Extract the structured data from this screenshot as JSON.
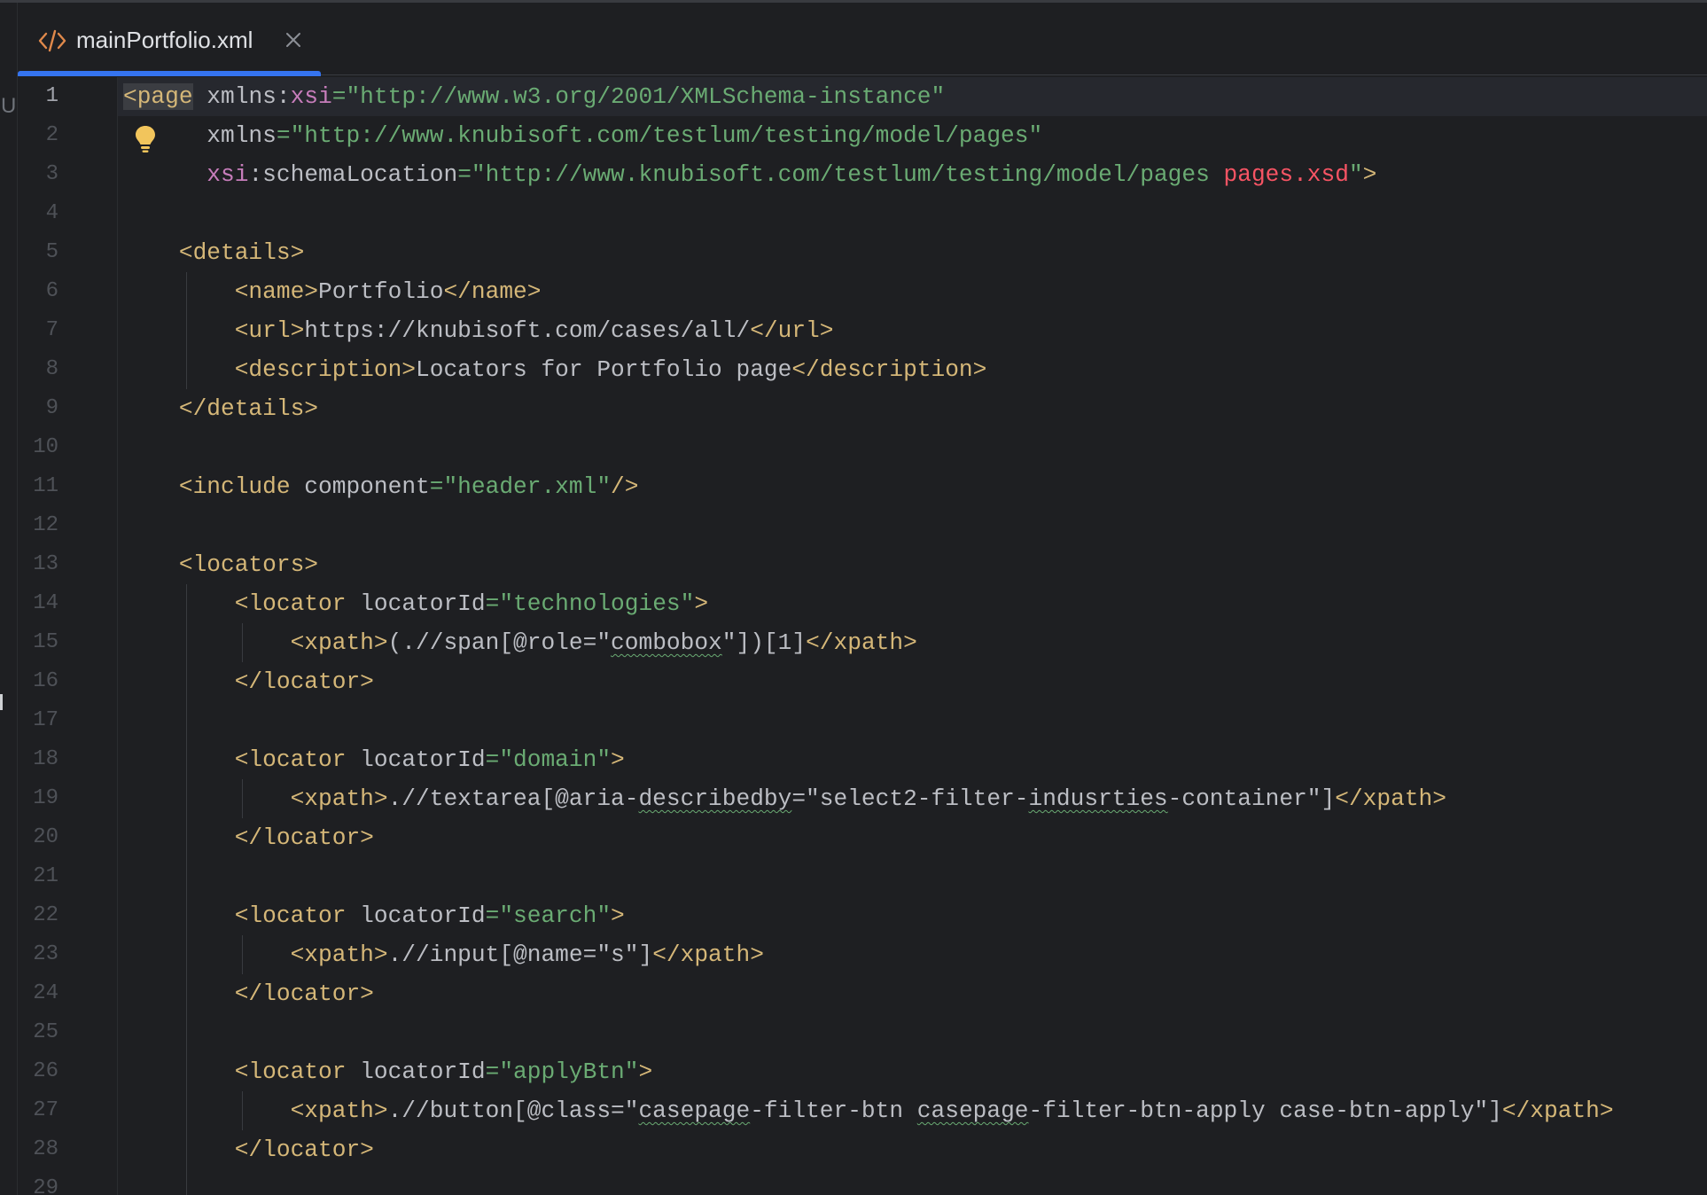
{
  "editor": {
    "tab": {
      "title": "mainPortfolio.xml",
      "icon": "xml-file-icon",
      "close_icon": "close-icon",
      "accent_color": "#3574f0"
    },
    "side_strip_label": "U",
    "colors": {
      "background": "#1e1f22",
      "tag": "#d5b778",
      "attribute": "#bcbec4",
      "namespace": "#c77dbb",
      "string": "#6aab73",
      "error": "#f75464",
      "line_number": "#4e5157"
    },
    "line_numbers": [
      "1",
      "2",
      "3",
      "4",
      "5",
      "6",
      "7",
      "8",
      "9",
      "10",
      "11",
      "12",
      "13",
      "14",
      "15",
      "16",
      "17",
      "18",
      "19",
      "20",
      "21",
      "22",
      "23",
      "24",
      "25",
      "26",
      "27",
      "28",
      "29"
    ],
    "code_lines": [
      [
        {
          "t": "<page",
          "c": "tag",
          "hl": true
        },
        {
          "t": " xmlns:",
          "c": "attr"
        },
        {
          "t": "xsi",
          "c": "ns"
        },
        {
          "t": "=\"http://www.w3.org/2001/XMLSchema-instance\"",
          "c": "str"
        }
      ],
      [
        {
          "t": "      xmlns",
          "c": "attr"
        },
        {
          "t": "=\"http://www.knubisoft.com/testlum/testing/model/pages\"",
          "c": "str"
        }
      ],
      [
        {
          "t": "      ",
          "c": "attr"
        },
        {
          "t": "xsi",
          "c": "ns"
        },
        {
          "t": ":schemaLocation",
          "c": "attr"
        },
        {
          "t": "=\"http://www.knubisoft.com/testlum/testing/model/pages ",
          "c": "str"
        },
        {
          "t": "pages.xsd",
          "c": "err"
        },
        {
          "t": "\"",
          "c": "str"
        },
        {
          "t": ">",
          "c": "tag"
        }
      ],
      [],
      [
        {
          "t": "    <details>",
          "c": "tag"
        }
      ],
      [
        {
          "t": "        <name>",
          "c": "tag"
        },
        {
          "t": "Portfolio",
          "c": "text"
        },
        {
          "t": "</name>",
          "c": "tag"
        }
      ],
      [
        {
          "t": "        <url>",
          "c": "tag"
        },
        {
          "t": "https://knubisoft.com/cases/all/",
          "c": "text"
        },
        {
          "t": "</url>",
          "c": "tag"
        }
      ],
      [
        {
          "t": "        <description>",
          "c": "tag"
        },
        {
          "t": "Locators for Portfolio page",
          "c": "text"
        },
        {
          "t": "</description>",
          "c": "tag"
        }
      ],
      [
        {
          "t": "    </details>",
          "c": "tag"
        }
      ],
      [],
      [
        {
          "t": "    <include",
          "c": "tag"
        },
        {
          "t": " component",
          "c": "attr"
        },
        {
          "t": "=\"header.xml\"",
          "c": "str"
        },
        {
          "t": "/>",
          "c": "tag"
        }
      ],
      [],
      [
        {
          "t": "    <locators>",
          "c": "tag"
        }
      ],
      [
        {
          "t": "        <locator",
          "c": "tag"
        },
        {
          "t": " locatorId",
          "c": "attr"
        },
        {
          "t": "=\"technologies\"",
          "c": "str"
        },
        {
          "t": ">",
          "c": "tag"
        }
      ],
      [
        {
          "t": "            <xpath>",
          "c": "tag"
        },
        {
          "t": "(.//span[@role=\"",
          "c": "text"
        },
        {
          "t": "combobox",
          "c": "text",
          "typo": true
        },
        {
          "t": "\"])[1]",
          "c": "text"
        },
        {
          "t": "</xpath>",
          "c": "tag"
        }
      ],
      [
        {
          "t": "        </locator>",
          "c": "tag"
        }
      ],
      [],
      [
        {
          "t": "        <locator",
          "c": "tag"
        },
        {
          "t": " locatorId",
          "c": "attr"
        },
        {
          "t": "=\"domain\"",
          "c": "str"
        },
        {
          "t": ">",
          "c": "tag"
        }
      ],
      [
        {
          "t": "            <xpath>",
          "c": "tag"
        },
        {
          "t": ".//textarea[@aria-",
          "c": "text"
        },
        {
          "t": "describedby",
          "c": "text",
          "typo": true
        },
        {
          "t": "=\"select2-filter-",
          "c": "text"
        },
        {
          "t": "indusrties",
          "c": "text",
          "typo": true
        },
        {
          "t": "-container\"]",
          "c": "text"
        },
        {
          "t": "</xpath>",
          "c": "tag"
        }
      ],
      [
        {
          "t": "        </locator>",
          "c": "tag"
        }
      ],
      [],
      [
        {
          "t": "        <locator",
          "c": "tag"
        },
        {
          "t": " locatorId",
          "c": "attr"
        },
        {
          "t": "=\"search\"",
          "c": "str"
        },
        {
          "t": ">",
          "c": "tag"
        }
      ],
      [
        {
          "t": "            <xpath>",
          "c": "tag"
        },
        {
          "t": ".//input[@name=\"s\"]",
          "c": "text"
        },
        {
          "t": "</xpath>",
          "c": "tag"
        }
      ],
      [
        {
          "t": "        </locator>",
          "c": "tag"
        }
      ],
      [],
      [
        {
          "t": "        <locator",
          "c": "tag"
        },
        {
          "t": " locatorId",
          "c": "attr"
        },
        {
          "t": "=\"applyBtn\"",
          "c": "str"
        },
        {
          "t": ">",
          "c": "tag"
        }
      ],
      [
        {
          "t": "            <xpath>",
          "c": "tag"
        },
        {
          "t": ".//button[@class=\"",
          "c": "text"
        },
        {
          "t": "casepage",
          "c": "text",
          "typo": true
        },
        {
          "t": "-filter-btn ",
          "c": "text"
        },
        {
          "t": "casepage",
          "c": "text",
          "typo": true
        },
        {
          "t": "-filter-btn-apply case-btn-apply\"]",
          "c": "text"
        },
        {
          "t": "</xpath>",
          "c": "tag"
        }
      ],
      [
        {
          "t": "        </locator>",
          "c": "tag"
        }
      ],
      []
    ]
  }
}
